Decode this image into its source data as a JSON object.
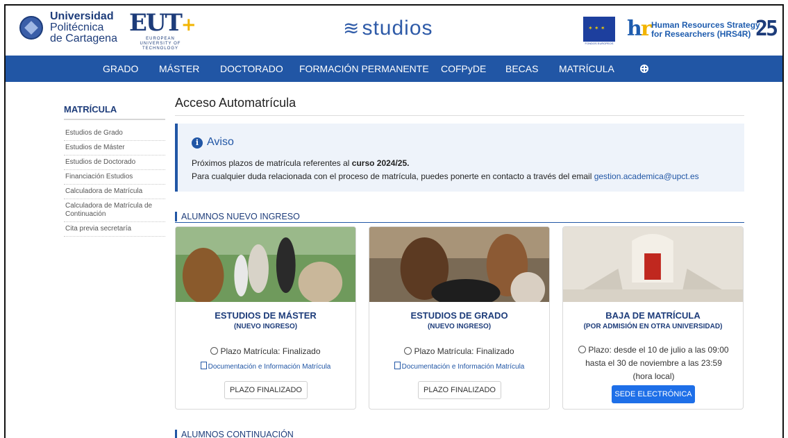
{
  "header": {
    "university": [
      "Universidad",
      "Politécnica",
      "de Cartagena"
    ],
    "eut_name": "EUT",
    "eut_sub": "EUROPEAN UNIVERSITY OF TECHNOLOGY",
    "portal_title": "studios",
    "eu_label": "FONDOS EUROPEOS",
    "hrs4r": [
      "Human Resources Strategy",
      "for Researchers (HRS4R)"
    ],
    "anniversary": "25"
  },
  "nav": {
    "items": [
      "GRADO",
      "MÁSTER",
      "DOCTORADO",
      "FORMACIÓN PERMANENTE",
      "COFPyDE",
      "BECAS",
      "MATRÍCULA"
    ]
  },
  "sidebar": {
    "title": "MATRÍCULA",
    "items": [
      "Estudios de Grado",
      "Estudios de Máster",
      "Estudios de Doctorado",
      "Financiación Estudios",
      "Calculadora de Matrícula",
      "Calculadora de Matrícula de Continuación",
      "Cita previa secretaría"
    ]
  },
  "main": {
    "title": "Acceso Automatrícula",
    "aviso": {
      "heading": "Aviso",
      "line1_prefix": "Próximos plazos de matrícula referentes al ",
      "line1_bold": "curso 2024/25.",
      "line2": "Para cualquier duda relacionada con el proceso de matrícula, puedes ponerte en contacto a través del email ",
      "email": "gestion.academica@upct.es"
    },
    "section1": "ALUMNOS NUEVO INGRESO",
    "section2": "ALUMNOS CONTINUACIÓN",
    "cards": [
      {
        "title": "ESTUDIOS DE MÁSTER",
        "subtitle": "(NUEVO INGRESO)",
        "plazo": "Plazo Matrícula: Finalizado",
        "doc": "Documentación e Información Matrícula",
        "button": "PLAZO FINALIZADO"
      },
      {
        "title": "ESTUDIOS DE GRADO",
        "subtitle": "(NUEVO INGRESO)",
        "plazo": "Plazo Matrícula: Finalizado",
        "doc": "Documentación e Información Matrícula",
        "button": "PLAZO FINALIZADO"
      },
      {
        "title": "BAJA DE MATRÍCULA",
        "subtitle": "(POR ADMISIÓN EN OTRA UNIVERSIDAD)",
        "plazo": "Plazo: desde el 10 de julio a las 09:00 hasta el 30 de noviembre a las 23:59 (hora local)",
        "button": "SEDE ELECTRÓNICA"
      }
    ]
  },
  "colors": {
    "brand_blue": "#2156a5",
    "button_blue": "#1e6fe8",
    "accent_gold": "#f2b400"
  },
  "icons": [
    "globe-icon",
    "info-icon",
    "clock-icon",
    "document-icon"
  ]
}
